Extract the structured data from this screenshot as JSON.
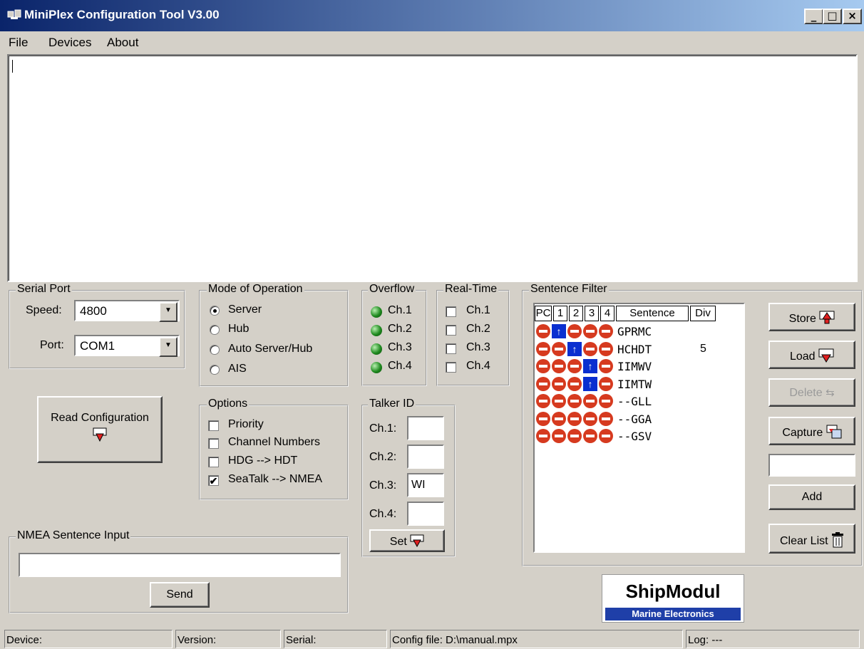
{
  "window": {
    "title": "MiniPlex Configuration Tool V3.00"
  },
  "titlebar_buttons": {
    "minimize": "_",
    "maximize": "□",
    "close": "×"
  },
  "menu": {
    "file": "File",
    "devices": "Devices",
    "about": "About"
  },
  "serial_port": {
    "title": "Serial Port",
    "speed_label": "Speed:",
    "speed_value": "4800",
    "port_label": "Port:",
    "port_value": "COM1"
  },
  "read_config": {
    "label": "Read Configuration"
  },
  "mode": {
    "title": "Mode of Operation",
    "options": [
      "Server",
      "Hub",
      "Auto Server/Hub",
      "AIS"
    ],
    "selected": "Server"
  },
  "options": {
    "title": "Options",
    "items": [
      {
        "label": "Priority",
        "checked": false
      },
      {
        "label": "Channel Numbers",
        "checked": false
      },
      {
        "label": "HDG --> HDT",
        "checked": false
      },
      {
        "label": "SeaTalk --> NMEA",
        "checked": true
      }
    ]
  },
  "overflow": {
    "title": "Overflow",
    "channels": [
      "Ch.1",
      "Ch.2",
      "Ch.3",
      "Ch.4"
    ],
    "led_color": "#1f8a1f"
  },
  "realtime": {
    "title": "Real-Time",
    "channels": [
      "Ch.1",
      "Ch.2",
      "Ch.3",
      "Ch.4"
    ]
  },
  "talker": {
    "title": "Talker ID",
    "rows": [
      {
        "label": "Ch.1:",
        "value": ""
      },
      {
        "label": "Ch.2:",
        "value": ""
      },
      {
        "label": "Ch.3:",
        "value": "WI"
      },
      {
        "label": "Ch.4:",
        "value": ""
      }
    ],
    "set_label": "Set"
  },
  "filter": {
    "title": "Sentence Filter",
    "headers": [
      "PC",
      "1",
      "2",
      "3",
      "4",
      "Sentence",
      "Div"
    ],
    "rows": [
      {
        "cells": [
          "stop",
          "up",
          "stop",
          "stop",
          "stop"
        ],
        "sentence": "GPRMC",
        "div": ""
      },
      {
        "cells": [
          "stop",
          "stop",
          "up",
          "stop",
          "stop"
        ],
        "sentence": "HCHDT",
        "div": "5"
      },
      {
        "cells": [
          "stop",
          "stop",
          "stop",
          "up",
          "stop"
        ],
        "sentence": "IIMWV",
        "div": ""
      },
      {
        "cells": [
          "stop",
          "stop",
          "stop",
          "up",
          "stop"
        ],
        "sentence": "IIMTW",
        "div": ""
      },
      {
        "cells": [
          "stop",
          "stop",
          "stop",
          "stop",
          "stop"
        ],
        "sentence": "--GLL",
        "div": ""
      },
      {
        "cells": [
          "stop",
          "stop",
          "stop",
          "stop",
          "stop"
        ],
        "sentence": "--GGA",
        "div": ""
      },
      {
        "cells": [
          "stop",
          "stop",
          "stop",
          "stop",
          "stop"
        ],
        "sentence": "--GSV",
        "div": ""
      }
    ],
    "stop_color": "#d63a1f",
    "up_color": "#0a2fd0"
  },
  "side_buttons": {
    "store": "Store",
    "load": "Load",
    "delete": "Delete",
    "capture": "Capture",
    "add": "Add",
    "clear": "Clear List",
    "add_field_value": ""
  },
  "nmea": {
    "title": "NMEA Sentence Input",
    "input_value": "",
    "send_label": "Send"
  },
  "logo": {
    "top": "ShipModul",
    "bottom": "Marine Electronics"
  },
  "status": {
    "device": "Device:",
    "version": "Version:",
    "serial": "Serial:",
    "config": "Config file: D:\\manual.mpx",
    "log": "Log: ---"
  }
}
